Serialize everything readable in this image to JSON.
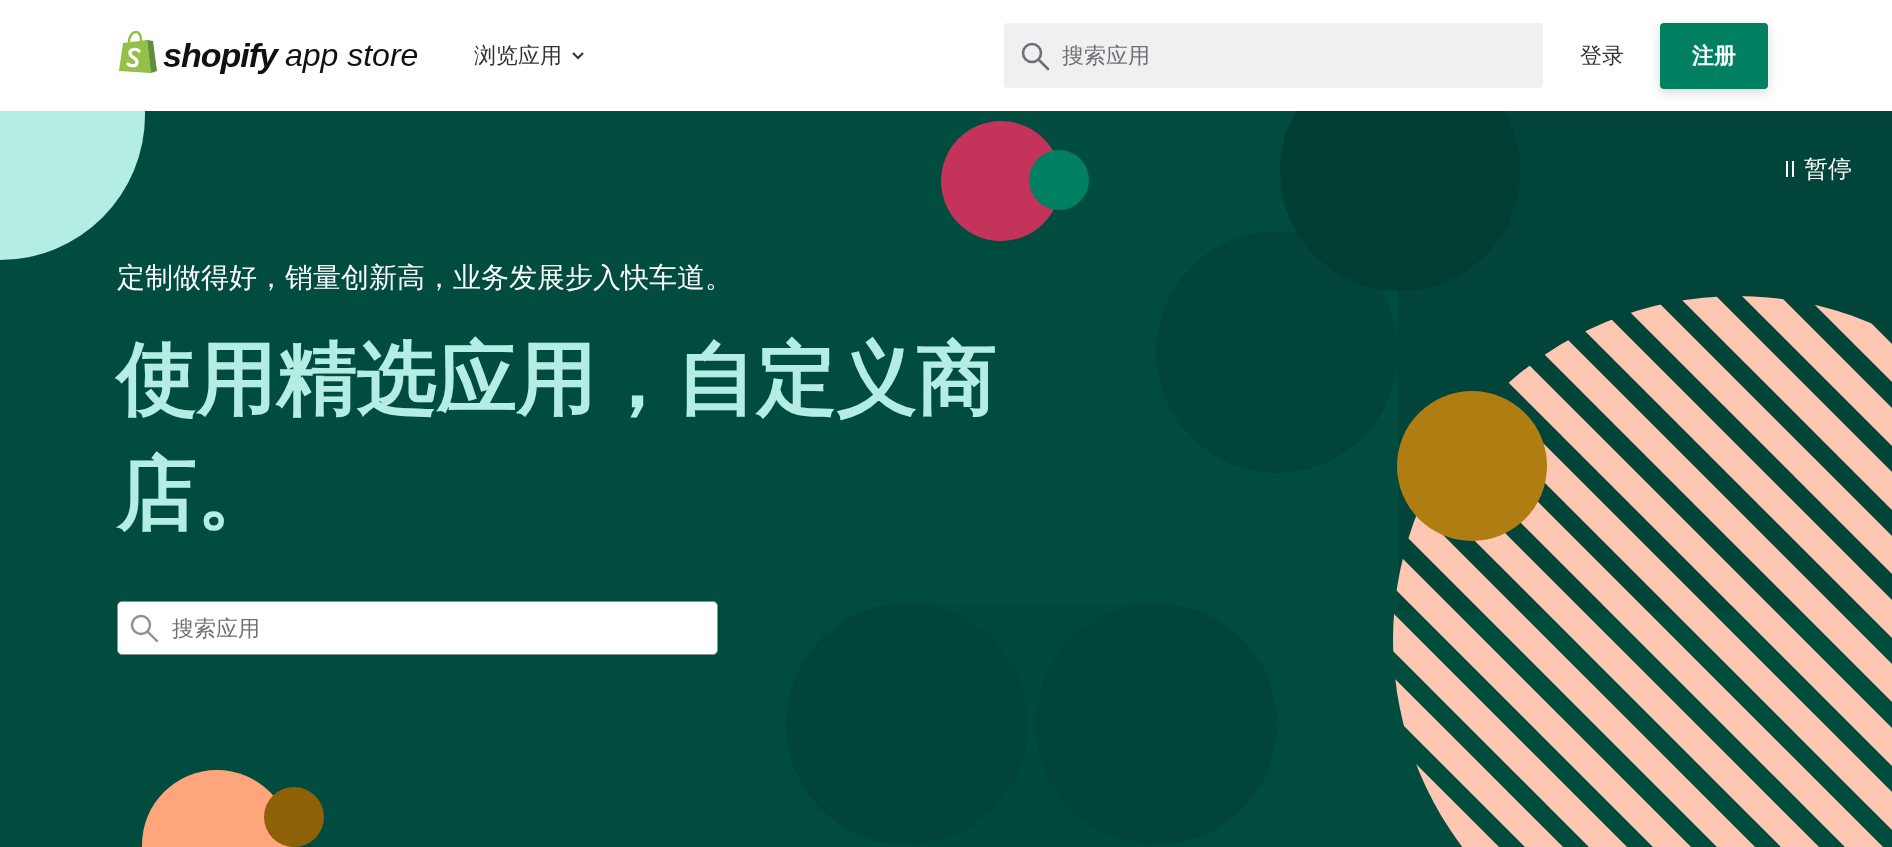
{
  "header": {
    "logo": {
      "brand": "shopify",
      "suffix": "app store"
    },
    "browse_menu": {
      "label": "浏览应用"
    },
    "search": {
      "placeholder": "搜索应用"
    },
    "login": "登录",
    "signup": "注册"
  },
  "hero": {
    "pause": {
      "label": "暂停"
    },
    "subtitle": "定制做得好，销量创新高，业务发展步入快车道。",
    "title": "使用精选应用，自定义商店。",
    "search": {
      "placeholder": "搜索应用"
    }
  }
}
